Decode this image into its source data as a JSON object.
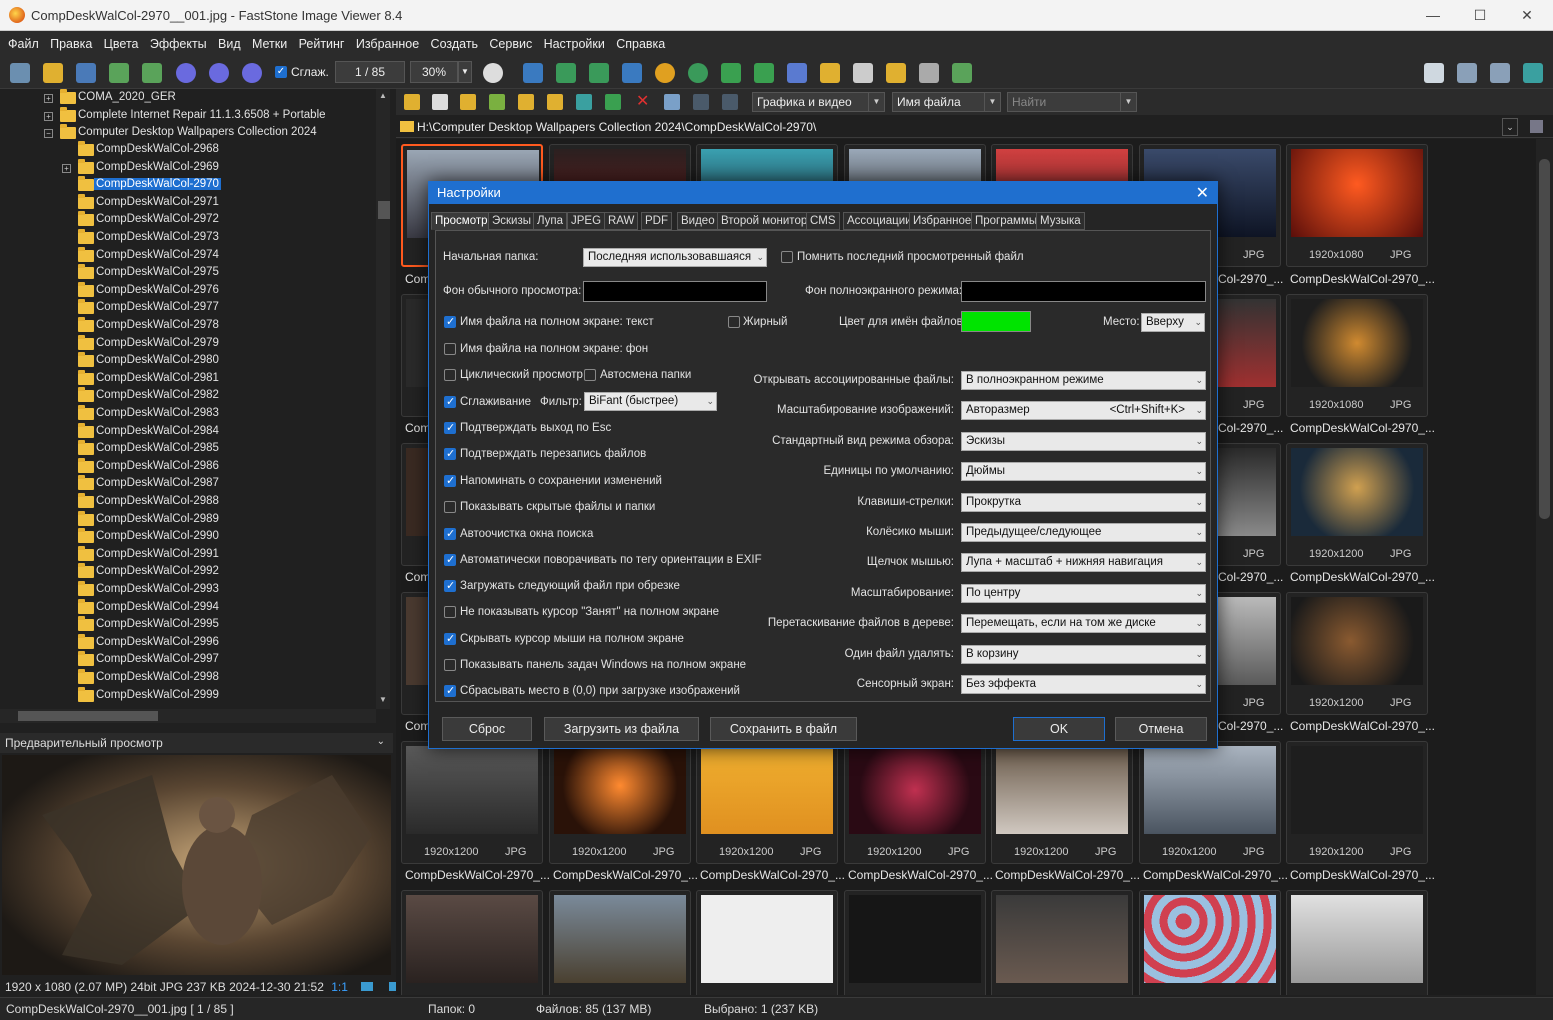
{
  "window": {
    "title": "CompDeskWalCol-2970__001.jpg  -  FastStone Image Viewer 8.4",
    "minimize": "—",
    "maximize": "☐",
    "close": "✕"
  },
  "menu": [
    "Файл",
    "Правка",
    "Цвета",
    "Эффекты",
    "Вид",
    "Метки",
    "Рейтинг",
    "Избранное",
    "Создать",
    "Сервис",
    "Настройки",
    "Справка"
  ],
  "toolbar": {
    "smooth_label": "Сглаж.",
    "page_counter": "1 / 85",
    "zoom": "30%"
  },
  "tree": {
    "top_items": [
      "COMA_2020_GER",
      "Complete Internet Repair 11.1.3.6508 + Portable",
      "Computer Desktop Wallpapers Collection 2024"
    ],
    "folders": [
      "CompDeskWalCol-2968",
      "CompDeskWalCol-2969",
      "CompDeskWalCol-2970",
      "CompDeskWalCol-2971",
      "CompDeskWalCol-2972",
      "CompDeskWalCol-2973",
      "CompDeskWalCol-2974",
      "CompDeskWalCol-2975",
      "CompDeskWalCol-2976",
      "CompDeskWalCol-2977",
      "CompDeskWalCol-2978",
      "CompDeskWalCol-2979",
      "CompDeskWalCol-2980",
      "CompDeskWalCol-2981",
      "CompDeskWalCol-2982",
      "CompDeskWalCol-2983",
      "CompDeskWalCol-2984",
      "CompDeskWalCol-2985",
      "CompDeskWalCol-2986",
      "CompDeskWalCol-2987",
      "CompDeskWalCol-2988",
      "CompDeskWalCol-2989",
      "CompDeskWalCol-2990",
      "CompDeskWalCol-2991",
      "CompDeskWalCol-2992",
      "CompDeskWalCol-2993",
      "CompDeskWalCol-2994",
      "CompDeskWalCol-2995",
      "CompDeskWalCol-2996",
      "CompDeskWalCol-2997",
      "CompDeskWalCol-2998",
      "CompDeskWalCol-2999"
    ],
    "selected": "CompDeskWalCol-2970"
  },
  "preview": {
    "header": "Предварительный просмотр",
    "info": "1920 x 1080 (2.07 MP)  24bit  JPG   237 KB   2024-12-30 21:52",
    "ratio": "1:1"
  },
  "status": {
    "file": "CompDeskWalCol-2970__001.jpg [ 1 / 85 ]",
    "folders": "Папок: 0",
    "files": "Файлов: 85 (137 MB)",
    "selected": "Выбрано: 1 (237 KB)"
  },
  "browser": {
    "filter": "Графика и видео",
    "sort": "Имя файла",
    "search_placeholder": "Найти",
    "path": "H:\\Computer Desktop Wallpapers Collection 2024\\CompDeskWalCol-2970\\"
  },
  "thumbs": {
    "caption": "CompDeskWalCol-2970_...",
    "short_caption": "Com",
    "right_caption": "Col-2970_...",
    "format": "JPG",
    "col6": [
      {
        "res": "1920x1080",
        "fmt": "JPG"
      },
      {
        "res": "1920x1080",
        "fmt": "JPG"
      },
      {
        "res": "1920x1200",
        "fmt": "JPG"
      },
      {
        "res": "1920x1200",
        "fmt": "JPG"
      }
    ],
    "row5": [
      {
        "res": "1920x1200",
        "fmt": "JPG"
      },
      {
        "res": "1920x1200",
        "fmt": "JPG"
      },
      {
        "res": "1920x1200",
        "fmt": "JPG"
      },
      {
        "res": "1920x1200",
        "fmt": "JPG"
      },
      {
        "res": "1920x1200",
        "fmt": "JPG"
      },
      {
        "res": "1920x1200",
        "fmt": "JPG"
      },
      {
        "res": "1920x1200",
        "fmt": "JPG"
      }
    ]
  },
  "dialog": {
    "title": "Настройки",
    "close": "✕",
    "tabs": [
      "Просмотр",
      "Эскизы",
      "Лупа",
      "JPEG",
      "RAW",
      "PDF",
      "Видео",
      "Второй монитор",
      "CMS",
      "Ассоциации",
      "Избранное",
      "Программы",
      "Музыка"
    ],
    "start_folder_label": "Начальная папка:",
    "start_folder_value": "Последняя использовавшаяся",
    "remember_last": "Помнить последний просмотренный файл",
    "bg_normal": "Фон обычного просмотра:",
    "bg_fullscreen": "Фон полноэкранного режима:",
    "fn_fullscreen_text": "Имя файла на полном экране: текст",
    "bold": "Жирный",
    "fn_color": "Цвет для имён файлов:",
    "place": "Место:",
    "place_value": "Вверху",
    "fn_fullscreen_bg": "Имя файла на полном экране: фон",
    "cyclic": "Циклический просмотр",
    "auto_folder": "Автосмена папки",
    "smoothing": "Сглаживание",
    "filter_label": "Фильтр:",
    "filter_value": "BiFant (быстрее)",
    "confirm_esc": "Подтверждать выход по Esc",
    "confirm_overwrite": "Подтверждать перезапись файлов",
    "remind_save": "Напоминать о сохранении изменений",
    "show_hidden": "Показывать скрытые файлы и папки",
    "autoclear_search": "Автоочистка окна поиска",
    "auto_rotate": "Автоматически поворачивать по тегу ориентации в EXIF",
    "load_next": "Загружать следующий файл при обрезке",
    "no_busy_cursor": "Не показывать курсор \"Занят\" на полном экране",
    "hide_cursor": "Скрывать курсор мыши на полном экране",
    "show_taskbar": "Показывать панель задач Windows на полном экране",
    "reset_pos": "Сбрасывать место в (0,0) при загрузке изображений",
    "right": [
      {
        "label": "Открывать ассоциированные файлы:",
        "value": "В полноэкранном режиме",
        "extra": ""
      },
      {
        "label": "Масштабирование изображений:",
        "value": "Авторазмер",
        "extra": "<Ctrl+Shift+K>"
      },
      {
        "label": "Стандартный вид режима обзора:",
        "value": "Эскизы",
        "extra": ""
      },
      {
        "label": "Единицы по умолчанию:",
        "value": "Дюймы",
        "extra": ""
      },
      {
        "label": "Клавиши-стрелки:",
        "value": "Прокрутка",
        "extra": ""
      },
      {
        "label": "Колёсико мыши:",
        "value": "Предыдущее/следующее",
        "extra": ""
      },
      {
        "label": "Щелчок мышью:",
        "value": "Лупа + масштаб + нижняя навигация",
        "extra": ""
      },
      {
        "label": "Масштабирование:",
        "value": "По центру",
        "extra": ""
      },
      {
        "label": "Перетаскивание файлов в дереве:",
        "value": "Перемещать, если на том же диске",
        "extra": ""
      },
      {
        "label": "Один файл удалять:",
        "value": "В корзину",
        "extra": ""
      },
      {
        "label": "Сенсорный экран:",
        "value": "Без эффекта",
        "extra": ""
      }
    ],
    "btn_reset": "Сброс",
    "btn_load": "Загрузить из файла",
    "btn_save": "Сохранить в файл",
    "btn_ok": "OK",
    "btn_cancel": "Отмена",
    "colors": {
      "fn_color": "#00e400",
      "bg": "#000000",
      "accent": "#1f6fcf"
    }
  }
}
